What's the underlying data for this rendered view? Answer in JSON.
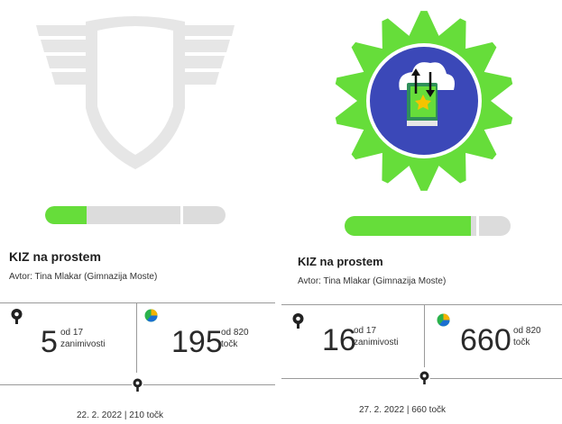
{
  "colors": {
    "accent": "#66dd3a",
    "emblem_locked": "#e6e6e6",
    "emblem_blue": "#3b48b8",
    "track": "#dcdcdc"
  },
  "cards": [
    {
      "state": "locked",
      "progress_fraction": 0.23,
      "title": "KIZ na prostem",
      "author": "Avtor: Tina Mlakar (Gimnazija Moste)",
      "interests": {
        "icon": "key-icon",
        "value": "5",
        "of": "od 17",
        "unit": "zanimivosti"
      },
      "points": {
        "icon": "pie-chart-icon",
        "value": "195",
        "of": "od 820",
        "unit": "točk"
      },
      "footer_icon": "key-icon",
      "date": "22. 2. 2022 | 210 točk"
    },
    {
      "state": "unlocked",
      "progress_fraction": 0.76,
      "title": "KIZ na prostem",
      "author": "Avtor: Tina Mlakar (Gimnazija Moste)",
      "interests": {
        "icon": "key-icon",
        "value": "16",
        "of": "od 17",
        "unit": "zanimivosti"
      },
      "points": {
        "icon": "pie-chart-icon",
        "value": "660",
        "of": "od 820",
        "unit": "točk"
      },
      "footer_icon": "key-icon",
      "date": "27. 2. 2022 | 660 točk"
    }
  ]
}
